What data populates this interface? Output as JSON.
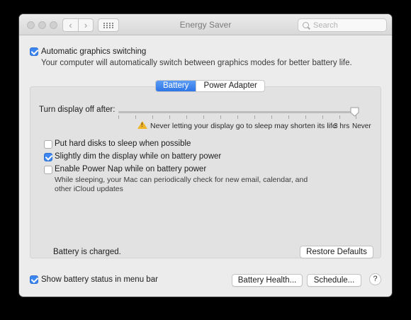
{
  "window": {
    "title": "Energy Saver",
    "search_placeholder": "Search"
  },
  "graphics": {
    "label": "Automatic graphics switching",
    "checked": true,
    "description": "Your computer will automatically switch between graphics modes for better battery life."
  },
  "tabs": [
    {
      "label": "Battery",
      "active": true
    },
    {
      "label": "Power Adapter",
      "active": false
    }
  ],
  "display_sleep": {
    "label": "Turn display off after:",
    "value": "Never",
    "warning": "Never letting your display go to sleep may shorten its life",
    "tick_3hrs": "3 hrs",
    "tick_never": "Never"
  },
  "options": [
    {
      "label": "Put hard disks to sleep when possible",
      "checked": false
    },
    {
      "label": "Slightly dim the display while on battery power",
      "checked": true
    },
    {
      "label": "Enable Power Nap while on battery power",
      "checked": false,
      "description": "While sleeping, your Mac can periodically check for new email, calendar, and other iCloud updates"
    }
  ],
  "battery_status": "Battery is charged.",
  "buttons": {
    "restore_defaults": "Restore Defaults",
    "battery_health": "Battery Health...",
    "schedule": "Schedule...",
    "help": "?"
  },
  "menu_bar": {
    "label": "Show battery status in menu bar",
    "checked": true
  },
  "colors": {
    "accent": "#3b86f0",
    "warning": "#f0b429"
  }
}
